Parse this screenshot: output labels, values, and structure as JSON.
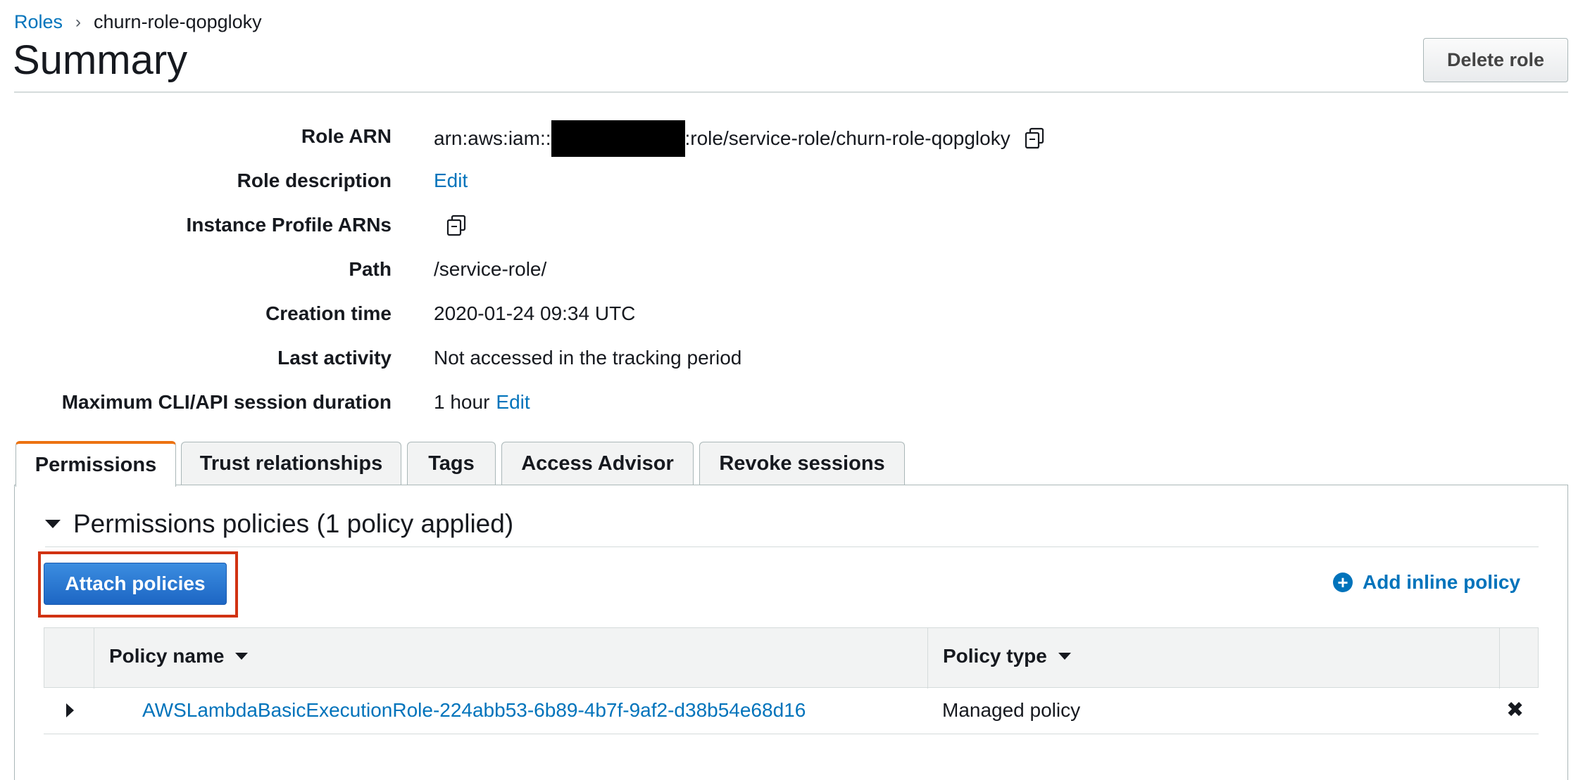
{
  "breadcrumb": {
    "root": "Roles",
    "separator": "›",
    "current": "churn-role-qopgloky"
  },
  "header": {
    "title": "Summary",
    "delete_label": "Delete role"
  },
  "summary": {
    "role_arn": {
      "label": "Role ARN",
      "prefix": "arn:aws:iam::",
      "suffix": ":role/service-role/churn-role-qopgloky"
    },
    "role_description": {
      "label": "Role description",
      "link": "Edit"
    },
    "instance_profile": {
      "label": "Instance Profile ARNs"
    },
    "path": {
      "label": "Path",
      "value": "/service-role/"
    },
    "creation_time": {
      "label": "Creation time",
      "value": "2020-01-24 09:34 UTC"
    },
    "last_activity": {
      "label": "Last activity",
      "value": "Not accessed in the tracking period"
    },
    "session_duration": {
      "label": "Maximum CLI/API session duration",
      "value": "1 hour",
      "link": "Edit"
    }
  },
  "tabs": [
    {
      "label": "Permissions",
      "active": true
    },
    {
      "label": "Trust relationships",
      "active": false
    },
    {
      "label": "Tags",
      "active": false
    },
    {
      "label": "Access Advisor",
      "active": false
    },
    {
      "label": "Revoke sessions",
      "active": false
    }
  ],
  "permissions": {
    "section_title": "Permissions policies (1 policy applied)",
    "attach_label": "Attach policies",
    "add_inline_label": "Add inline policy",
    "columns": {
      "name": "Policy name",
      "type": "Policy type"
    },
    "rows": [
      {
        "name": "AWSLambdaBasicExecutionRole-224abb53-6b89-4b7f-9af2-d38b54e68d16",
        "type": "Managed policy"
      }
    ]
  },
  "colors": {
    "link": "#0073bb",
    "active_tab_accent": "#ec7211",
    "primary_button": "#1d66c4",
    "highlight": "#d13212"
  },
  "icons": [
    "copy-icon",
    "caret-down-icon",
    "plus-circle-icon",
    "expand-caret-icon",
    "remove-x-icon",
    "sort-caret-icon"
  ]
}
